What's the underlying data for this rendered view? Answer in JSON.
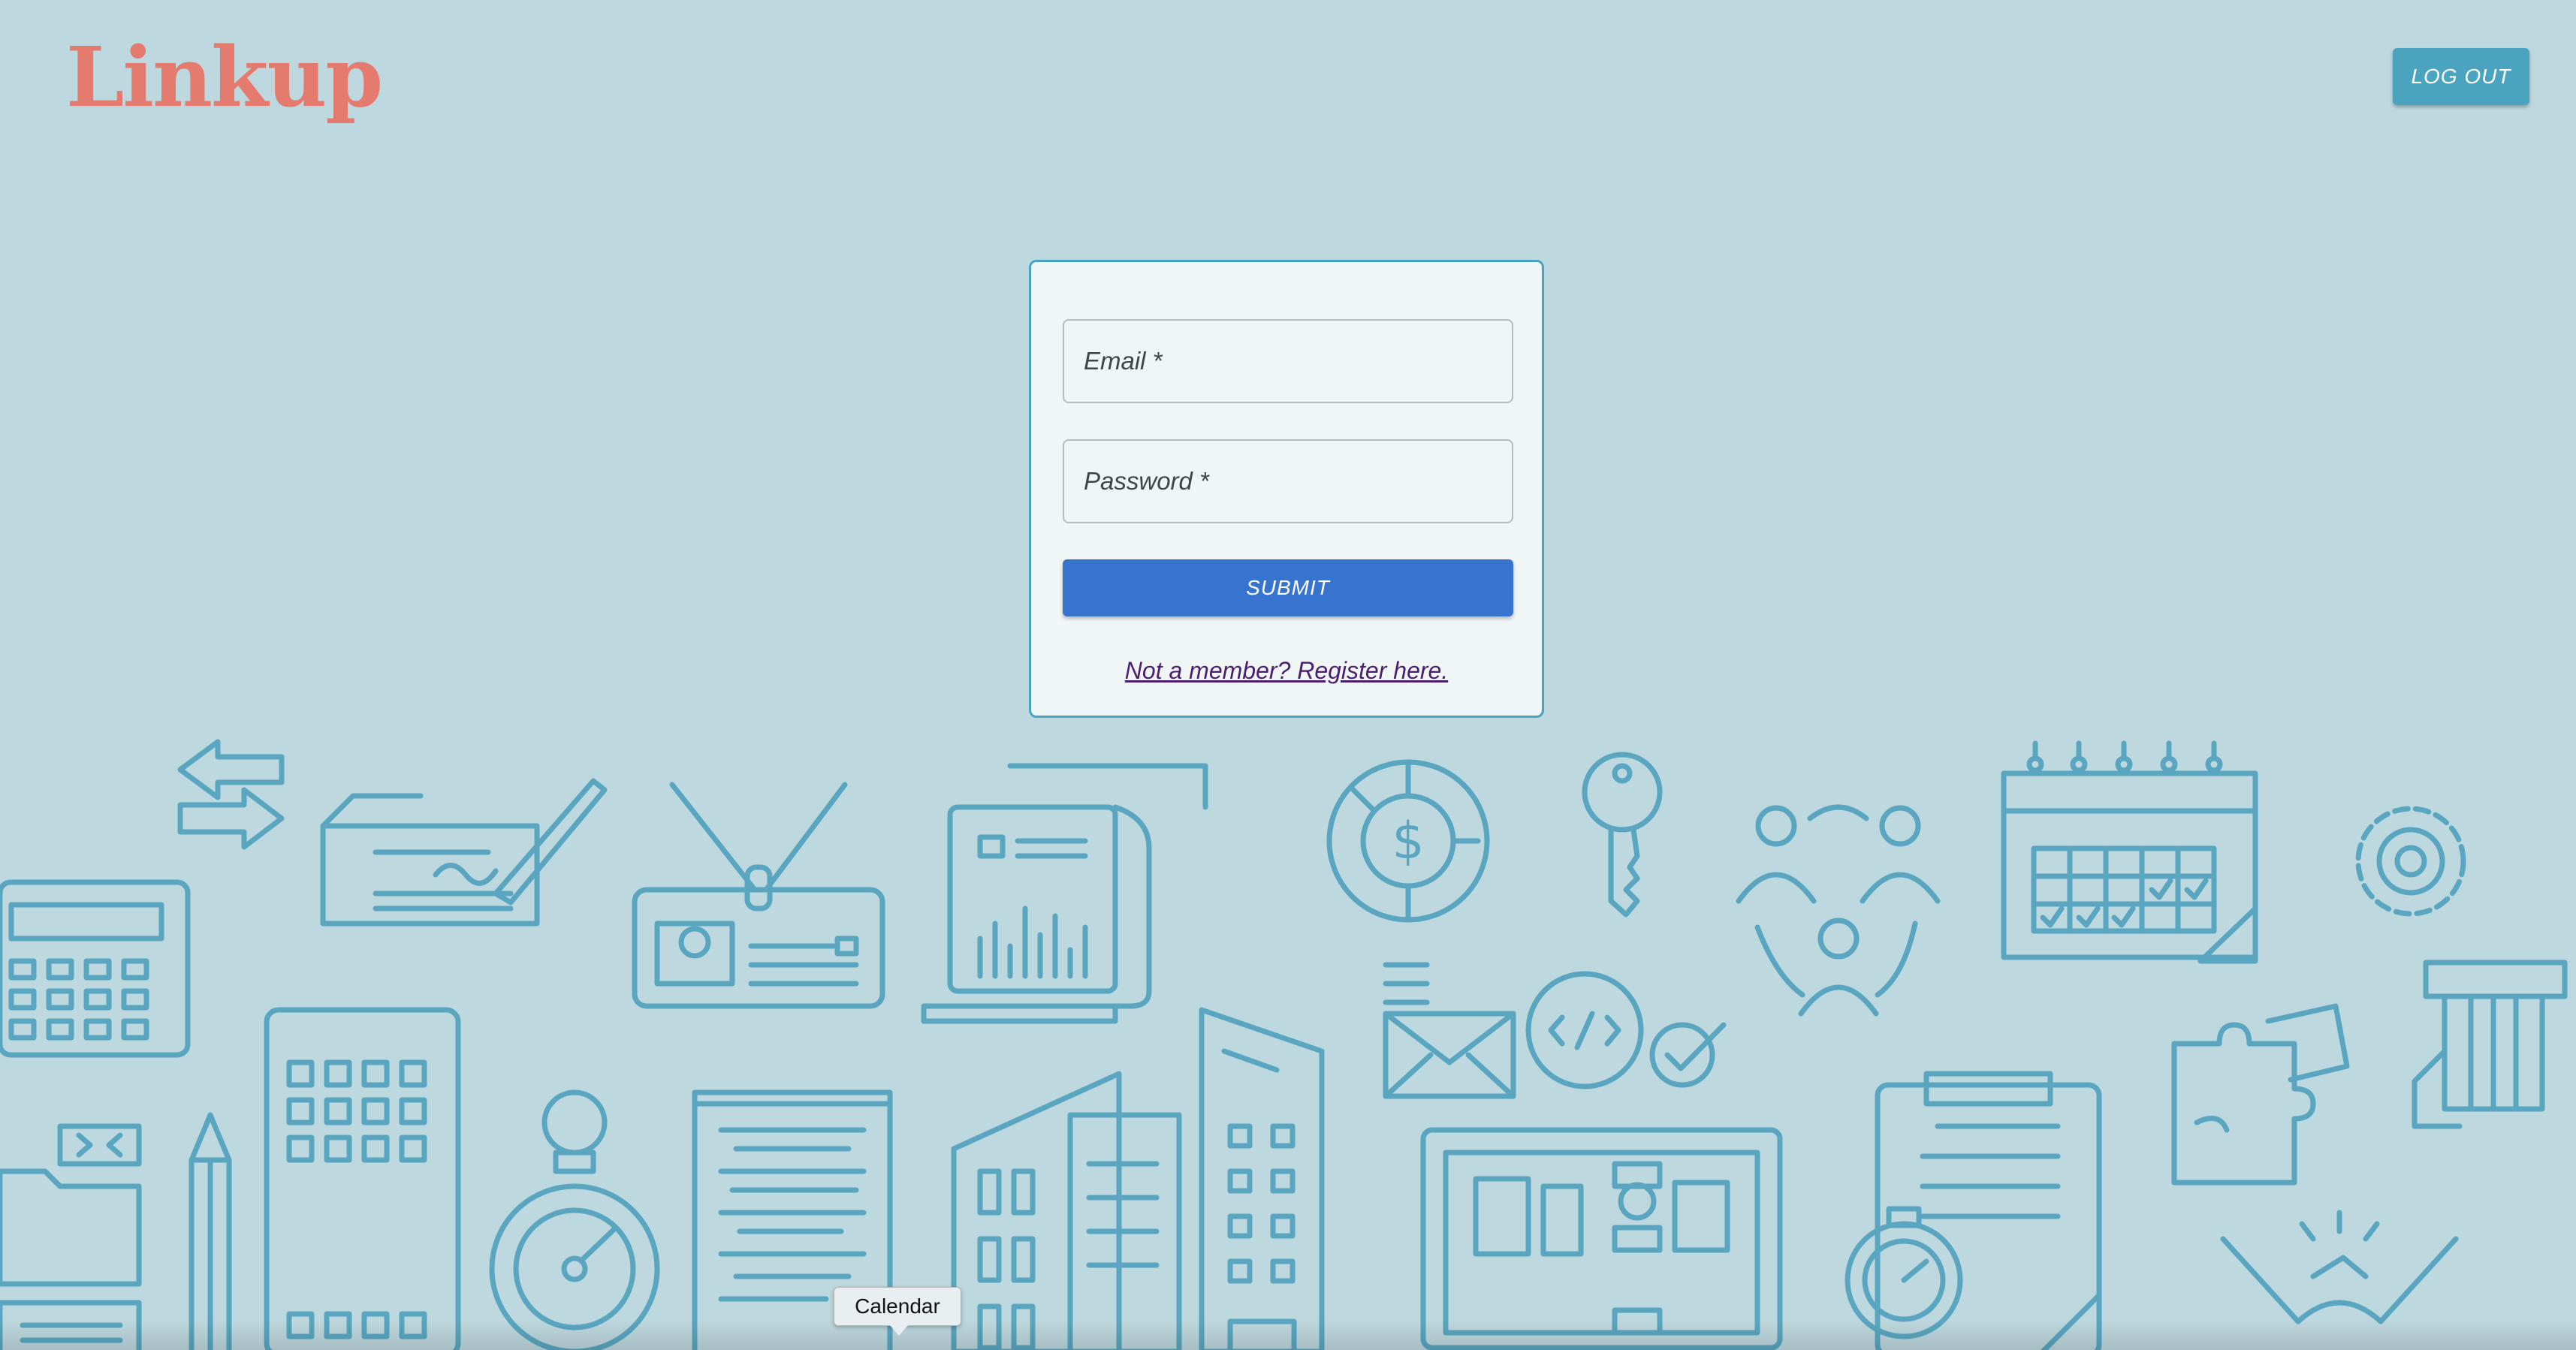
{
  "brand": {
    "logo_text": "Linkup"
  },
  "header": {
    "logout_label": "LOG OUT"
  },
  "login_form": {
    "email_placeholder": "Email *",
    "password_placeholder": "Password *",
    "submit_label": "SUBMIT",
    "register_link": "Not a member? Register here."
  },
  "tooltip": {
    "text": "Calendar"
  },
  "background": {
    "icons": [
      "calculator-icon",
      "arrows-icon",
      "signed-check-icon",
      "id-badge-icon",
      "report-document-icon",
      "dollar-chart-icon",
      "key-icon",
      "team-network-icon",
      "calendar-icon",
      "gear-icon",
      "smartphone-icon",
      "pencil-icon",
      "folder-icon",
      "stopwatch-icon",
      "text-document-icon",
      "office-buildings-icon",
      "envelope-icon",
      "code-bubble-icon",
      "check-circle-icon",
      "laptop-dashboard-icon",
      "clipboard-icon",
      "puzzle-icon",
      "credit-card-icon",
      "handshake-icon"
    ],
    "accent_color": "#5aa6c1",
    "background_color": "#bdd8de"
  }
}
